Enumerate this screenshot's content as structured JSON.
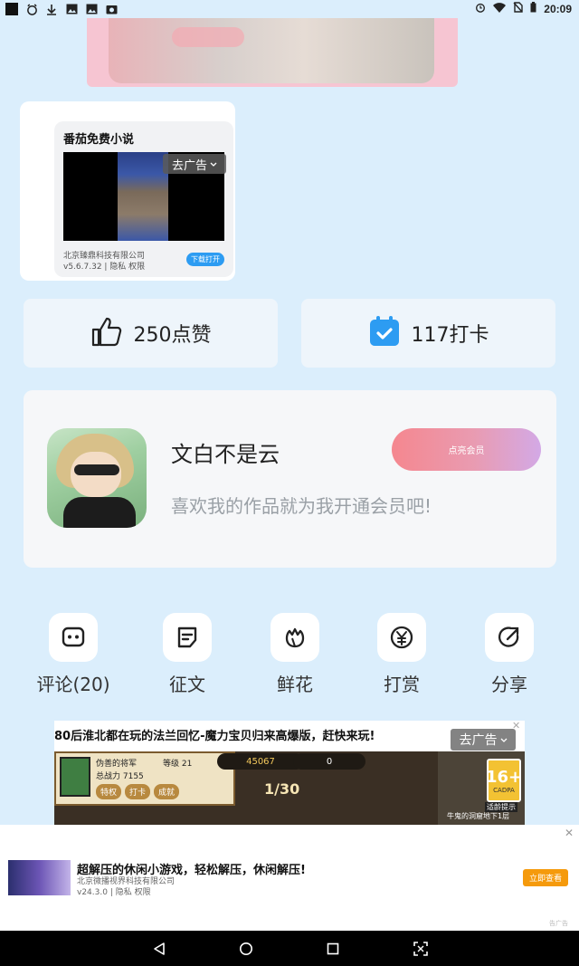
{
  "status_bar": {
    "time": "20:09"
  },
  "ad_card": {
    "title": "番茄免费小说",
    "remove_ad": "去广告",
    "company": "北京臻鼎科技有限公司",
    "version": "v5.6.7.32 | 隐私 权限",
    "download": "下载打开"
  },
  "stats": {
    "likes": "250点赞",
    "checkins": "117打卡"
  },
  "author": {
    "name": "文白不是云",
    "tip": "喜欢我的作品就为我开通会员吧!",
    "vip_button": "点亮会员"
  },
  "actions": [
    {
      "label": "评论(20)",
      "icon": "comment-icon"
    },
    {
      "label": "征文",
      "icon": "essay-icon"
    },
    {
      "label": "鲜花",
      "icon": "flower-icon"
    },
    {
      "label": "打赏",
      "icon": "yuan-icon"
    },
    {
      "label": "分享",
      "icon": "share-icon"
    }
  ],
  "game_ad": {
    "title": "80后淮北都在玩的法兰回忆-魔力宝贝归来高爆版，赶快来玩!",
    "remove_ad": "去广告",
    "char_name": "伪善的将军",
    "level": "等级 21",
    "power": "总战力 7155",
    "buttons": [
      "特权",
      "打卡",
      "成就"
    ],
    "gold": "45067",
    "gems": "0",
    "progress": "1/30",
    "map_caption": "牛鬼的洞窟地下1层",
    "age_rating": "16+",
    "age_org": "CADPA",
    "age_hint": "适龄提示"
  },
  "banner_ad": {
    "title": "超解压的休闲小游戏，轻松解压，休闲解压!",
    "company": "北京微播视界科技有限公司",
    "version": "v24.3.0 | 隐私 权限",
    "button": "立即查看",
    "tag": "告广告"
  },
  "colors": {
    "background": "#dbeefc",
    "checkin_blue": "#2d9cf2",
    "vip_gradient_start": "#f5878f",
    "vip_gradient_end": "#d3a9e6",
    "banner_button": "#f59a0c"
  }
}
